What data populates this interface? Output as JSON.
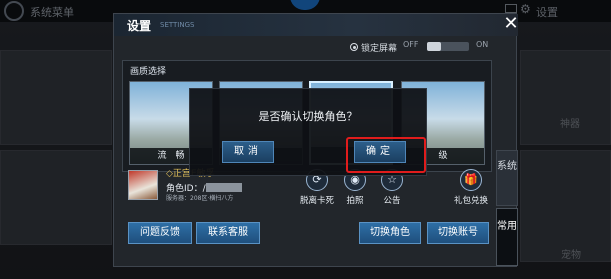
{
  "background": {
    "menu_title": "系统菜单",
    "settings_label": "设置",
    "tiles": [
      "神器",
      "宠物"
    ]
  },
  "panel": {
    "title": "设置",
    "subtitle": "SETTINGS",
    "close_icon": "close-icon",
    "lock_screen": {
      "label": "锁定屏幕",
      "off": "OFF",
      "on": "ON",
      "state": "off"
    },
    "quality": {
      "title": "画质选择",
      "options": [
        {
          "label": "流　畅",
          "selected": false
        },
        {
          "label": "",
          "selected": false
        },
        {
          "label": "",
          "selected": true
        },
        {
          "label": "级",
          "selected": false
        }
      ]
    },
    "profile": {
      "name": "◇正宫E敏孚",
      "id_label": "角色ID：",
      "id_value": "/",
      "server": "服务器：208区·横扫八方"
    },
    "actions": [
      {
        "label": "脱离卡死",
        "icon": "refresh-icon"
      },
      {
        "label": "拍照",
        "icon": "camera-icon"
      },
      {
        "label": "公告",
        "icon": "star-icon"
      },
      {
        "label": "礼包兑换",
        "icon": "gift-icon"
      }
    ],
    "bottom_buttons": {
      "feedback": "问题反馈",
      "support": "联系客服",
      "switch_role": "切换角色",
      "switch_account": "切换账号"
    },
    "side_tabs": [
      {
        "label": "系统",
        "active": false
      },
      {
        "label": "常用",
        "active": true
      }
    ]
  },
  "dialog": {
    "message": "是否确认切换角色？",
    "cancel": "取消",
    "confirm": "确定"
  },
  "colors": {
    "accent": "#2e6fa6",
    "highlight": "#e01c1c",
    "name_gold": "#e4c25a"
  }
}
